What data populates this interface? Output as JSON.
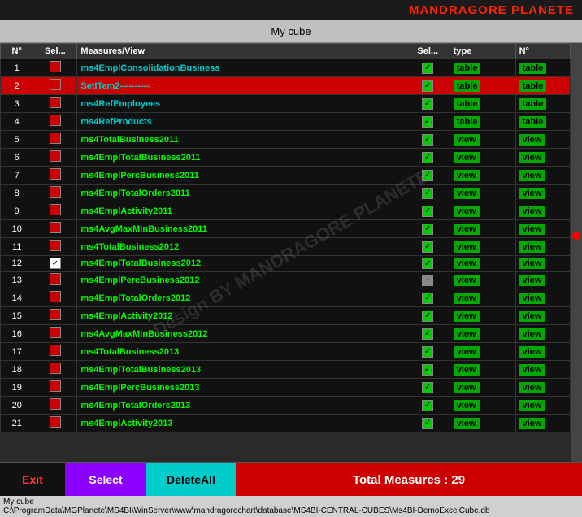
{
  "header": {
    "title": "MANDRAGORE PLANETE"
  },
  "cube_title": "My cube",
  "columns": {
    "n": "N°",
    "sel1": "Sel...",
    "measures": "Measures/View",
    "sel2": "Sel...",
    "type": "type",
    "n2": "N°"
  },
  "rows": [
    {
      "n": 1,
      "sel": false,
      "name": "ms4EmplConsolidationBusiness",
      "checked": true,
      "type": "table",
      "n2": "table",
      "rowStyle": "black"
    },
    {
      "n": 2,
      "sel": false,
      "name": "SetITem2----------",
      "checked": true,
      "type": "table",
      "n2": "table",
      "rowStyle": "red"
    },
    {
      "n": 3,
      "sel": false,
      "name": "ms4RefEmployees",
      "checked": true,
      "type": "table",
      "n2": "table",
      "rowStyle": "black"
    },
    {
      "n": 4,
      "sel": false,
      "name": "ms4RefProducts",
      "checked": true,
      "type": "table",
      "n2": "table",
      "rowStyle": "black"
    },
    {
      "n": 5,
      "sel": false,
      "name": "ms4TotalBusiness2011",
      "checked": true,
      "type": "view",
      "n2": "view",
      "rowStyle": "black"
    },
    {
      "n": 6,
      "sel": false,
      "name": "ms4EmplTotalBusiness2011",
      "checked": true,
      "type": "view",
      "n2": "view",
      "rowStyle": "black"
    },
    {
      "n": 7,
      "sel": false,
      "name": "ms4EmplPercBusiness2011",
      "checked": true,
      "type": "view",
      "n2": "view",
      "rowStyle": "black"
    },
    {
      "n": 8,
      "sel": false,
      "name": "ms4EmplTotalOrders2011",
      "checked": true,
      "type": "view",
      "n2": "view",
      "rowStyle": "black"
    },
    {
      "n": 9,
      "sel": false,
      "name": "ms4EmplActivity2011",
      "checked": true,
      "type": "view",
      "n2": "view",
      "rowStyle": "black"
    },
    {
      "n": 10,
      "sel": false,
      "name": "ms4AvgMaxMinBusiness2011",
      "checked": true,
      "type": "view",
      "n2": "view",
      "rowStyle": "black"
    },
    {
      "n": 11,
      "sel": false,
      "name": "ms4TotalBusiness2012",
      "checked": true,
      "type": "view",
      "n2": "view",
      "rowStyle": "black"
    },
    {
      "n": 12,
      "sel": true,
      "name": "ms4EmplTotalBusiness2012",
      "checked": true,
      "type": "view",
      "n2": "view",
      "rowStyle": "black"
    },
    {
      "n": 13,
      "sel": false,
      "name": "ms4EmplPercBusiness2012",
      "checked": false,
      "type": "view",
      "n2": "view",
      "rowStyle": "black"
    },
    {
      "n": 14,
      "sel": false,
      "name": "ms4EmplTotalOrders2012",
      "checked": true,
      "type": "view",
      "n2": "view",
      "rowStyle": "black"
    },
    {
      "n": 15,
      "sel": false,
      "name": "ms4EmplActivity2012",
      "checked": true,
      "type": "view",
      "n2": "view",
      "rowStyle": "black"
    },
    {
      "n": 16,
      "sel": false,
      "name": "ms4AvgMaxMinBusiness2012",
      "checked": true,
      "type": "view",
      "n2": "view",
      "rowStyle": "black"
    },
    {
      "n": 17,
      "sel": false,
      "name": "ms4TotalBusiness2013",
      "checked": true,
      "type": "view",
      "n2": "view",
      "rowStyle": "black"
    },
    {
      "n": 18,
      "sel": false,
      "name": "ms4EmplTotalBusiness2013",
      "checked": true,
      "type": "view",
      "n2": "view",
      "rowStyle": "black"
    },
    {
      "n": 19,
      "sel": false,
      "name": "ms4EmplPercBusiness2013",
      "checked": true,
      "type": "view",
      "n2": "view",
      "rowStyle": "black"
    },
    {
      "n": 20,
      "sel": false,
      "name": "ms4EmplTotalOrders2013",
      "checked": true,
      "type": "view",
      "n2": "view",
      "rowStyle": "black"
    },
    {
      "n": 21,
      "sel": false,
      "name": "ms4EmplActivity2013",
      "checked": true,
      "type": "view",
      "n2": "view",
      "rowStyle": "black"
    }
  ],
  "total_measures_label": "Total Measures : 29",
  "buttons": {
    "exit": "Exit",
    "select": "Select",
    "delete": "DeleteAll"
  },
  "status": {
    "line1": "My cube",
    "line2": "C:\\ProgramData\\MGPlanete\\MS4BI\\WinServer\\www\\mandragorechart\\database\\MS4BI-CENTRAL-CUBES\\Ms4BI-DemoExcelCube.db"
  },
  "watermark": {
    "line1": "Design BY MANDRAGORE PLANETE"
  }
}
